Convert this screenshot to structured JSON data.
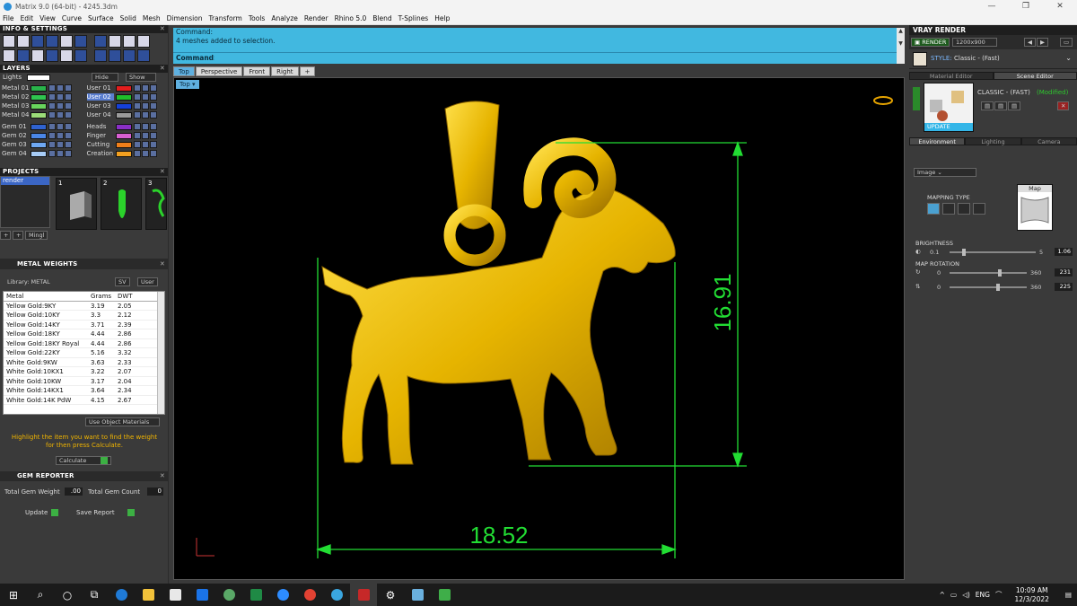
{
  "window": {
    "title": "Matrix 9.0 (64-bit) - 4245.3dm",
    "controls": [
      "—",
      "❐",
      "✕"
    ]
  },
  "menu": [
    "File",
    "Edit",
    "View",
    "Curve",
    "Surface",
    "Solid",
    "Mesh",
    "Dimension",
    "Transform",
    "Tools",
    "Analyze",
    "Render",
    "Rhino 5.0",
    "Blend",
    "T-Splines",
    "Help"
  ],
  "left": {
    "info_title": "INFO & SETTINGS",
    "layers_title": "LAYERS",
    "lights_label": "Lights",
    "hide_label": "Hide",
    "show_label": "Show",
    "layers_left": [
      {
        "name": "Metal 01",
        "color": "#29b34a"
      },
      {
        "name": "Metal 02",
        "color": "#2fc44f"
      },
      {
        "name": "Metal 03",
        "color": "#68d45c"
      },
      {
        "name": "Metal 04",
        "color": "#9bdc78"
      },
      {
        "name": "Gem 01",
        "color": "#2f62d0"
      },
      {
        "name": "Gem 02",
        "color": "#4a86e6"
      },
      {
        "name": "Gem 03",
        "color": "#6ea8f2"
      },
      {
        "name": "Gem 04",
        "color": "#a7ccf6"
      }
    ],
    "layers_right": [
      {
        "name": "User 01",
        "color": "#e21d1d"
      },
      {
        "name": "User 02",
        "color": "#1fbf2a",
        "selected": true
      },
      {
        "name": "User 03",
        "color": "#1540d8"
      },
      {
        "name": "User 04",
        "color": "#9a9a9a"
      },
      {
        "name": "Heads",
        "color": "#8a2fc7"
      },
      {
        "name": "Finger",
        "color": "#d85fd1"
      },
      {
        "name": "Cutting",
        "color": "#f07f1a"
      },
      {
        "name": "Creation",
        "color": "#f3a020"
      }
    ],
    "projects_title": "PROJECTS",
    "project_item": "render",
    "thumb_numbers": [
      "1",
      "2",
      "3"
    ],
    "mingl_label": "Mingl",
    "metal_title": "METAL WEIGHTS",
    "library_label": "Library: METAL",
    "sv_label": "SV",
    "user_label": "User",
    "table_headers": [
      "Metal",
      "Grams",
      "DWT"
    ],
    "table_rows": [
      [
        "Yellow Gold:9KY",
        "3.19",
        "2.05"
      ],
      [
        "Yellow Gold:10KY",
        "3.3",
        "2.12"
      ],
      [
        "Yellow Gold:14KY",
        "3.71",
        "2.39"
      ],
      [
        "Yellow Gold:18KY",
        "4.44",
        "2.86"
      ],
      [
        "Yellow Gold:18KY Royal",
        "4.44",
        "2.86"
      ],
      [
        "Yellow Gold:22KY",
        "5.16",
        "3.32"
      ],
      [
        "White Gold:9KW",
        "3.63",
        "2.33"
      ],
      [
        "White Gold:10KX1",
        "3.22",
        "2.07"
      ],
      [
        "White Gold:10KW",
        "3.17",
        "2.04"
      ],
      [
        "White Gold:14KX1",
        "3.64",
        "2.34"
      ],
      [
        "White Gold:14K PdW",
        "4.15",
        "2.67"
      ]
    ],
    "use_object_materials": "Use Object Materials",
    "hint": "Highlight the item you want to find the weight for then press Calculate.",
    "calculate_label": "Calculate",
    "gem_title": "GEM REPORTER",
    "total_gem_weight_label": "Total Gem Weight",
    "total_gem_weight_value": ".00",
    "total_gem_count_label": "Total Gem Count",
    "total_gem_count_value": "0",
    "update_label": "Update",
    "save_report_label": "Save Report"
  },
  "center": {
    "command_label": "Command:",
    "command_output": "4 meshes added to selection.",
    "command_prompt": "Command:",
    "tabs": [
      "Top",
      "Perspective",
      "Front",
      "Right",
      "+"
    ],
    "active_tab": "Top",
    "viewport_label": "Top",
    "dim_width": "18.52",
    "dim_height": "16.91"
  },
  "right": {
    "title": "VRAY RENDER",
    "render_label": "RENDER",
    "resolution": "1200x900",
    "style_label": "STYLE:",
    "style_value": "Classic - (Fast)",
    "tabs": [
      "Material Editor",
      "Scene Editor"
    ],
    "material_name": "CLASSIC - (FAST)",
    "material_state": "(Modified)",
    "update_label": "UPDATE",
    "env_tabs": [
      "Environment",
      "Lighting",
      "Camera"
    ],
    "env_select": "Image",
    "mapping_type_label": "MAPPING TYPE",
    "map_label": "Map",
    "brightness_label": "BRIGHTNESS",
    "brightness_min": "0.1",
    "brightness_max": "5",
    "brightness_value": "1.06",
    "map_rotation_label": "MAP ROTATION",
    "rot1_min": "0",
    "rot1_max": "360",
    "rot1_value": "231",
    "rot2_min": "0",
    "rot2_max": "360",
    "rot2_value": "225"
  },
  "taskbar": {
    "lang": "ENG",
    "time": "10:09 AM",
    "date": "12/3/2022"
  },
  "colors": {
    "accent": "#41b8e0",
    "dimension": "#22dd33",
    "gold": "#e6b400"
  }
}
